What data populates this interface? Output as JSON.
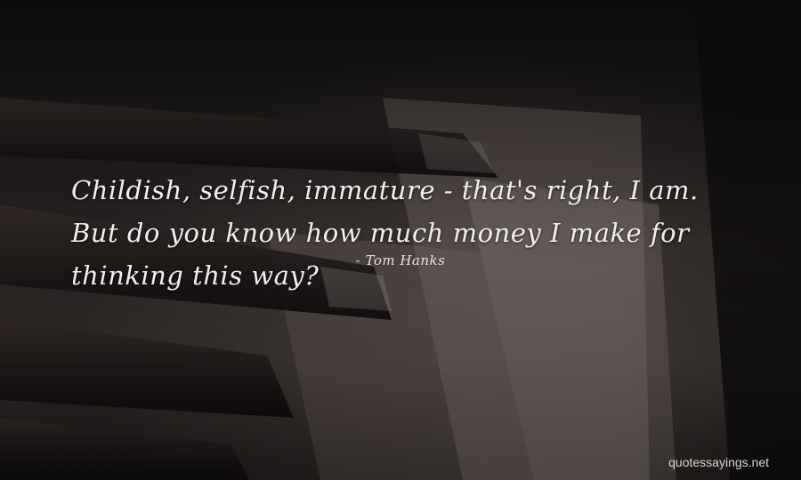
{
  "quote": {
    "text": "Childish, selfish, immature - that's right, I am. But do you know how much money I make for thinking this way?",
    "author": "- Tom Hanks"
  },
  "watermark": "quotessayings.net",
  "colors": {
    "text": "#f2f0ee",
    "background": "#1b1818"
  }
}
